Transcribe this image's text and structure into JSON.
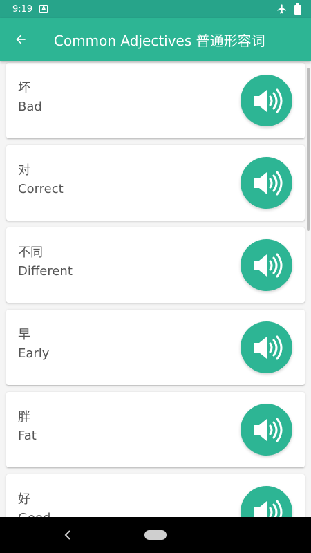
{
  "status_bar": {
    "time": "9:19",
    "a_icon_glyph": "A",
    "icons": [
      "airplane-icon",
      "battery-icon"
    ]
  },
  "app_bar": {
    "back_icon": "arrow-left-icon",
    "title": "Common Adjectives 普通形容词"
  },
  "colors": {
    "status_bar": "#27a48a",
    "primary": "#2db594",
    "card_text": "#555555",
    "background": "#f5f5f5"
  },
  "items": [
    {
      "chinese": "坏",
      "english": "Bad",
      "icon": "speaker-icon"
    },
    {
      "chinese": "对",
      "english": "Correct",
      "icon": "speaker-icon"
    },
    {
      "chinese": "不同",
      "english": "Different",
      "icon": "speaker-icon"
    },
    {
      "chinese": "早",
      "english": "Early",
      "icon": "speaker-icon"
    },
    {
      "chinese": "胖",
      "english": "Fat",
      "icon": "speaker-icon"
    },
    {
      "chinese": "好",
      "english": "Good",
      "icon": "speaker-icon"
    }
  ],
  "nav_bar": {
    "icons": [
      "nav-back-icon",
      "nav-home-pill"
    ]
  }
}
